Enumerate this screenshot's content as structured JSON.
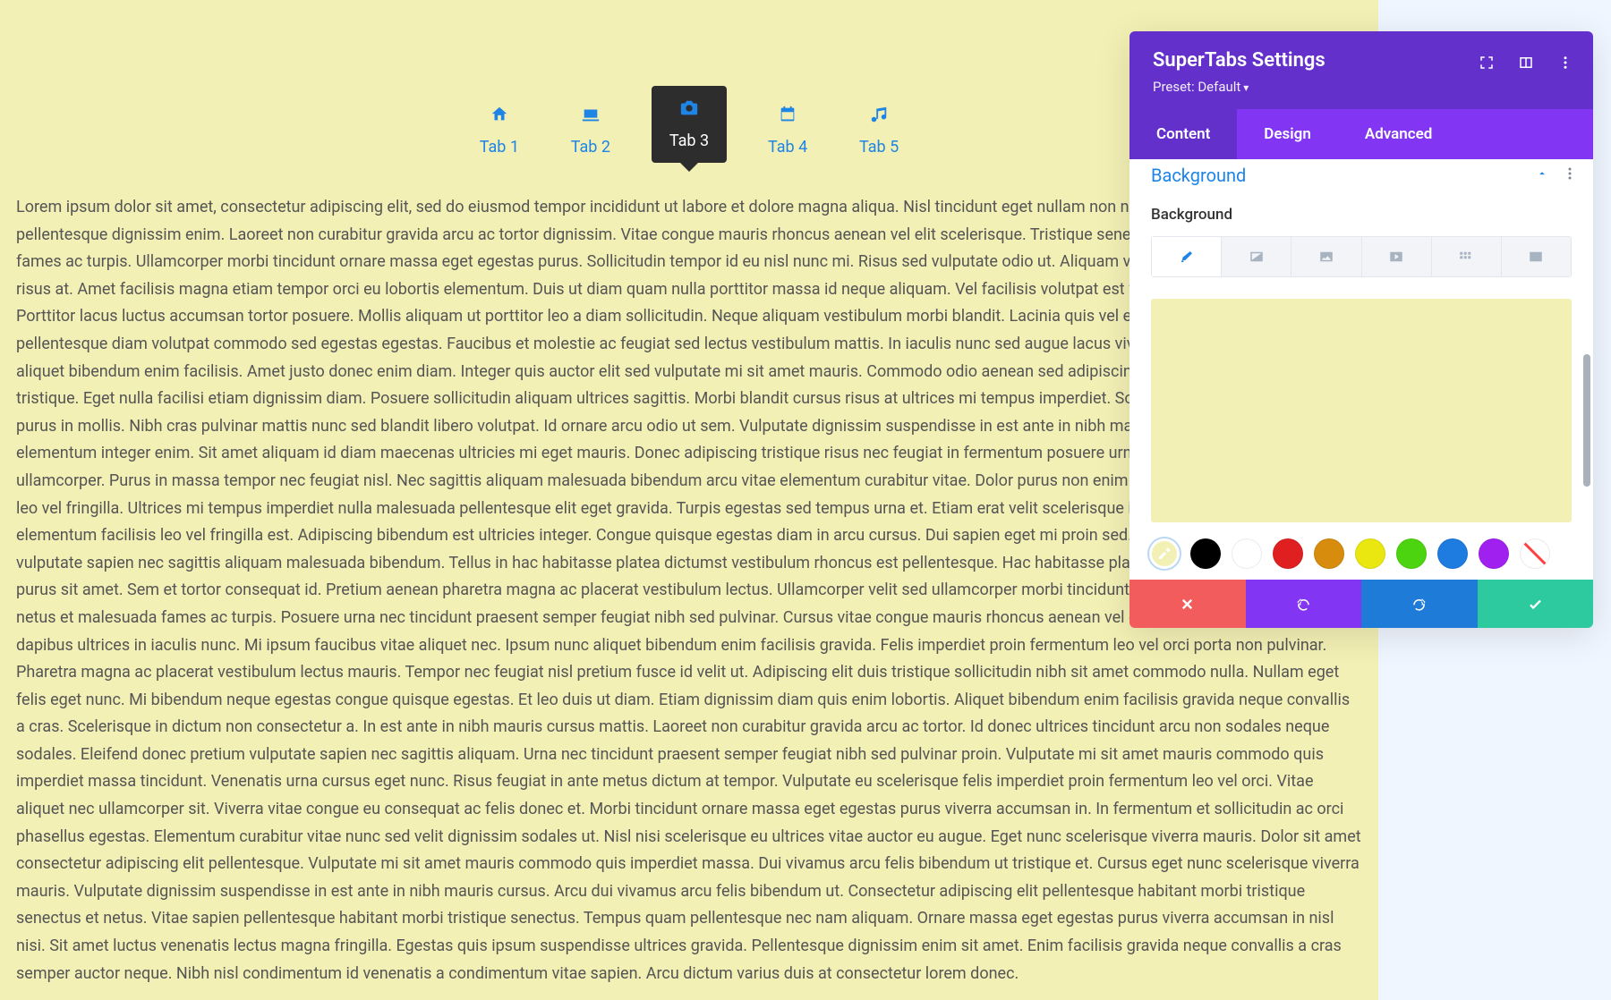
{
  "tabs": {
    "items": [
      {
        "label": "Tab 1",
        "icon": "home"
      },
      {
        "label": "Tab 2",
        "icon": "laptop"
      },
      {
        "label": "Tab 3",
        "icon": "camera",
        "active": true
      },
      {
        "label": "Tab 4",
        "icon": "calendar"
      },
      {
        "label": "Tab 5",
        "icon": "music"
      }
    ],
    "background": "#f3f0b5",
    "active_background": "#2d2d2d"
  },
  "content": {
    "body_text": "Lorem ipsum dolor sit amet, consectetur adipiscing elit, sed do eiusmod tempor incididunt ut labore et dolore magna aliqua. Nisl tincidunt eget nullam non nisi est sit. Placerat orci nulla pellentesque dignissim enim. Laoreet non curabitur gravida arcu ac tortor dignissim. Vitae congue mauris rhoncus aenean vel elit scelerisque. Tristique senectus et netus et malesuada fames ac turpis. Ullamcorper morbi tincidunt ornare massa eget egestas purus. Sollicitudin tempor id eu nisl nunc mi. Risus sed vulputate odio ut. Aliquam vestibulum morbi blandit cursus risus at. Amet facilisis magna etiam tempor orci eu lobortis elementum. Duis ut diam quam nulla porttitor massa id neque aliquam. Vel facilisis volutpat est velit egestas dui id ornare. Porttitor lacus luctus accumsan tortor posuere. Mollis aliquam ut porttitor leo a diam sollicitudin. Neque aliquam vestibulum morbi blandit. Lacinia quis vel eros donec. Donec et odio pellentesque diam volutpat commodo sed egestas egestas. Faucibus et molestie ac feugiat sed lectus vestibulum mattis. In iaculis nunc sed augue lacus viverra vitae congue. Ipsum nunc aliquet bibendum enim facilisis. Amet justo donec enim diam. Integer quis auctor elit sed vulputate mi sit amet mauris. Commodo odio aenean sed adipiscing diam donec adipiscing tristique. Eget nulla facilisi etiam dignissim diam. Posuere sollicitudin aliquam ultrices sagittis. Morbi blandit cursus risus at ultrices mi tempus imperdiet. Sodales ut etiam sit amet nisl purus in mollis. Nibh cras pulvinar mattis nunc sed blandit libero volutpat. Id ornare arcu odio ut sem. Vulputate dignissim suspendisse in est ante in nibh mauris cursus. Ut faucibus pulvinar elementum integer enim. Sit amet aliquam id diam maecenas ultricies mi eget mauris. Donec adipiscing tristique risus nec feugiat in fermentum posuere urna. Rhoncus est pellentesque elit ullamcorper. Purus in massa tempor nec feugiat nisl. Nec sagittis aliquam malesuada bibendum arcu vitae elementum curabitur vitae. Dolor purus non enim praesent elementum facilisis leo vel fringilla. Ultrices mi tempus imperdiet nulla malesuada pellentesque elit eget gravida. Turpis egestas sed tempus urna et. Etiam erat velit scelerisque in dictum. Non enim praesent elementum facilisis leo vel fringilla est. Adipiscing bibendum est ultricies integer. Congue quisque egestas diam in arcu cursus. Dui sapien eget mi proin sed. Eu nisl nunc mi ipsum. Pretium vulputate sapien nec sagittis aliquam malesuada bibendum. Tellus in hac habitasse platea dictumst vestibulum rhoncus est pellentesque. Hac habitasse platea dictumst quisque sagittis purus sit amet. Sem et tortor consequat id. Pretium aenean pharetra magna ac placerat vestibulum lectus. Ullamcorper velit sed ullamcorper morbi tincidunt. Morbi tristique senectus et netus et malesuada fames ac turpis. Posuere urna nec tincidunt praesent semper feugiat nibh sed pulvinar. Cursus vitae congue mauris rhoncus aenean vel elit. Donec ac odio tempor orci dapibus ultrices in iaculis nunc. Mi ipsum faucibus vitae aliquet nec. Ipsum nunc aliquet bibendum enim facilisis gravida. Felis imperdiet proin fermentum leo vel orci porta non pulvinar. Pharetra magna ac placerat vestibulum lectus mauris. Tempor nec feugiat nisl pretium fusce id velit ut. Adipiscing elit duis tristique sollicitudin nibh sit amet commodo nulla. Nullam eget felis eget nunc. Mi bibendum neque egestas congue quisque egestas. Et leo duis ut diam. Etiam dignissim diam quis enim lobortis. Aliquet bibendum enim facilisis gravida neque convallis a cras. Scelerisque in dictum non consectetur a. In est ante in nibh mauris cursus mattis. Laoreet non curabitur gravida arcu ac tortor. Id donec ultrices tincidunt arcu non sodales neque sodales. Eleifend donec pretium vulputate sapien nec sagittis aliquam. Urna nec tincidunt praesent semper feugiat nibh sed pulvinar proin. Vulputate mi sit amet mauris commodo quis imperdiet massa tincidunt. Venenatis urna cursus eget nunc. Risus feugiat in ante metus dictum at tempor. Vulputate eu scelerisque felis imperdiet proin fermentum leo vel orci. Vitae aliquet nec ullamcorper sit. Viverra vitae congue eu consequat ac felis donec et. Morbi tincidunt ornare massa eget egestas purus viverra accumsan in. In fermentum et sollicitudin ac orci phasellus egestas. Elementum curabitur vitae nunc sed velit dignissim sodales ut. Nisl nisi scelerisque eu ultrices vitae auctor eu augue. Eget nunc scelerisque viverra mauris. Dolor sit amet consectetur adipiscing elit pellentesque. Vulputate mi sit amet mauris commodo quis imperdiet massa. Dui vivamus arcu felis bibendum ut tristique et. Cursus eget nunc scelerisque viverra mauris. Vulputate dignissim suspendisse in est ante in nibh mauris cursus. Arcu dui vivamus arcu felis bibendum ut. Consectetur adipiscing elit pellentesque habitant morbi tristique senectus et netus. Vitae sapien pellentesque habitant morbi tristique senectus. Tempus quam pellentesque nec nam aliquam. Ornare massa eget egestas purus viverra accumsan in nisl nisi. Sit amet luctus venenatis lectus magna fringilla. Egestas quis ipsum suspendisse ultrices gravida. Pellentesque dignissim enim sit amet. Enim facilisis gravida neque convallis a cras semper auctor neque. Nibh nisl condimentum id venenatis a condimentum vitae sapien. Arcu dictum varius duis at consectetur lorem donec."
  },
  "panel": {
    "title": "SuperTabs Settings",
    "preset_label": "Preset: Default",
    "sections": {
      "content": "Content",
      "design": "Design",
      "advanced": "Advanced",
      "active": "content"
    },
    "accordion": {
      "title": "Background",
      "field_label": "Background"
    },
    "bg_types": [
      "color",
      "gradient",
      "image",
      "video",
      "pattern",
      "mask"
    ],
    "bg_type_active": "color",
    "current_color": "#f3f0b5",
    "swatches": [
      "#000000",
      "#ffffff",
      "#e02020",
      "#d78c0e",
      "#eae610",
      "#4cd410",
      "#1e7be0",
      "#a020f0"
    ]
  }
}
